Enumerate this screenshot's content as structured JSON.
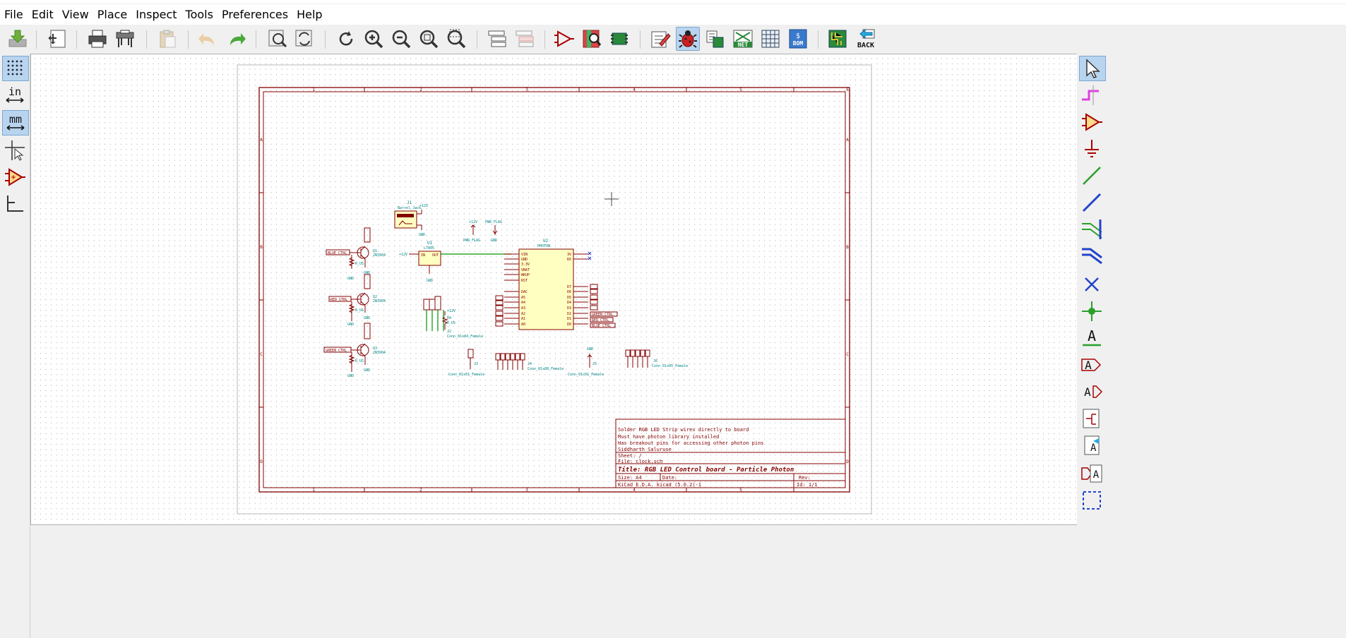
{
  "menu": [
    "File",
    "Edit",
    "View",
    "Place",
    "Inspect",
    "Tools",
    "Preferences",
    "Help"
  ],
  "toolbar": {
    "back_label": "BACK",
    "net_label": "NET",
    "bom_label": "BOM"
  },
  "left_toolbar": {
    "inch_label": "in",
    "mm_label": "mm"
  },
  "schematic": {
    "title_block": {
      "comments": [
        "Solder RGB LED Strip wires directly to board",
        "Must have photon library installed",
        "Has breakout pins for accessing other photon pins",
        "Siddharth Saluruse"
      ],
      "sheet": "Sheet: /",
      "file": "File: clock.sch",
      "title": "Title: RGB LED Control board - Particle Photon",
      "size": "Size: A4",
      "date": "Date:",
      "rev": "Rev:",
      "kicad": "KiCad E.D.A.  kicad (5.0.2)-1",
      "id": "Id: 1/1"
    },
    "border_cols": [
      "1",
      "2",
      "3",
      "4",
      "5",
      "6"
    ],
    "border_rows": [
      "A",
      "B",
      "C",
      "D"
    ],
    "components": {
      "j1_ref": "J1",
      "j1_val": "Barrel_Jack",
      "plus12v": "+12V",
      "gnd": "GND",
      "u1_ref": "U1",
      "u1_val": "L7805",
      "u1_in": "IN",
      "u1_out": "OUT",
      "u2_ref": "U2",
      "u2_val": "PHOTON",
      "pwr_flag": "PWR_FLAG",
      "q1_ref": "Q1",
      "q1_val": "2N3904",
      "q2_ref": "Q2",
      "q2_val": "2N3904",
      "q3_ref": "Q3",
      "q3_val": "2N3904",
      "r_val": "R_US",
      "blue_ctrl": "BLUE_CTRL",
      "red_ctrl": "RED_CTRL",
      "green_ctrl": "GREEN_CTRL",
      "j2_ref": "J2",
      "j2_val": "Conn_01x04_Female",
      "j3_ref": "J3",
      "j3_val": "Conn_01x01_Female",
      "j4_ref": "J4",
      "j4_val": "Conn_01x08_Female",
      "j5_ref": "J5",
      "j5_val": "Conn_01x01_Female",
      "j6_ref": "J6",
      "j6_val": "Conn_01x05_Female",
      "r4_ref": "R4",
      "photon_left_pins": [
        "VIN",
        "GND",
        "3.3V",
        "VBAT",
        "WKUP",
        "RST",
        "DAC",
        "A5",
        "A4",
        "A3",
        "A2",
        "A1",
        "A0"
      ],
      "photon_right_pins": [
        "3V",
        "RX",
        "D7",
        "D6",
        "D5",
        "D4",
        "D3",
        "D2",
        "D1",
        "D0"
      ]
    }
  },
  "colors": {
    "wire": "#009600",
    "component": "#840000",
    "text": "#008484",
    "body_fill": "#ffffc2"
  }
}
